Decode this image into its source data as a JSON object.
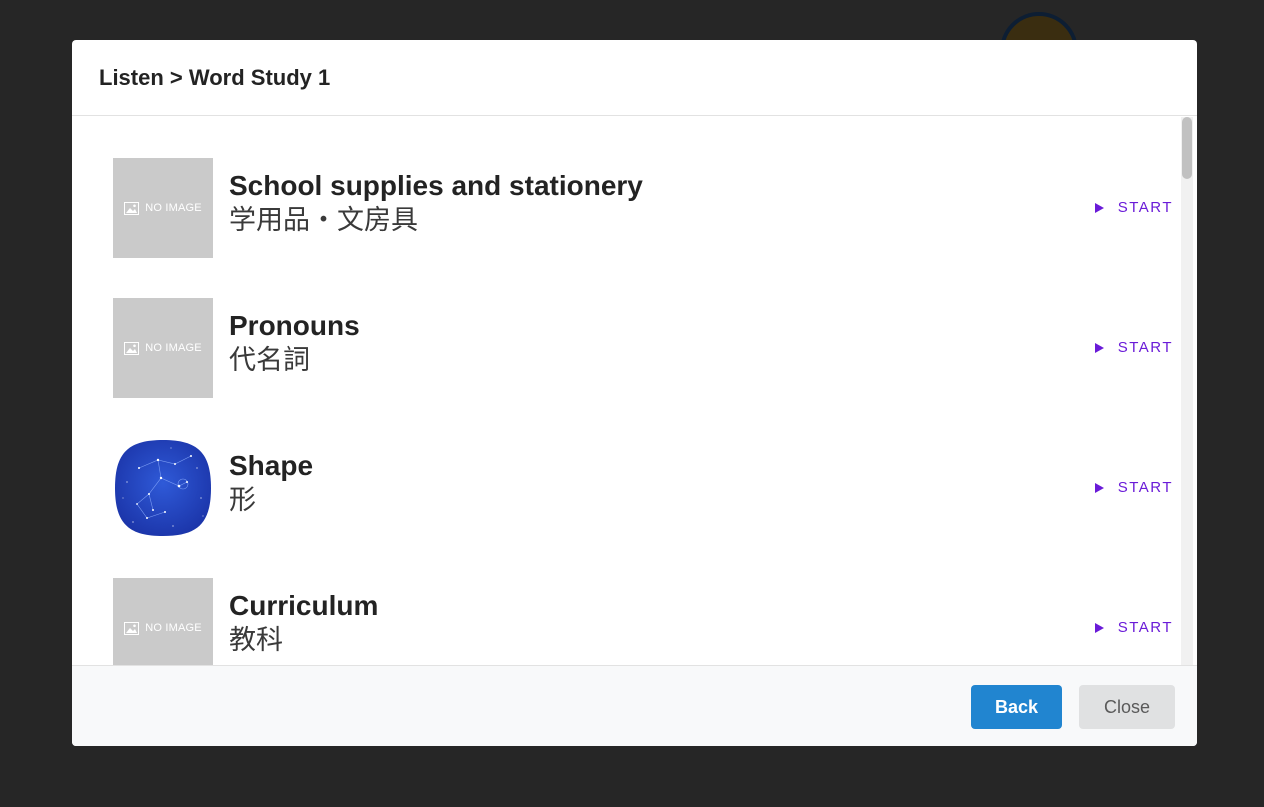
{
  "modal": {
    "title": "Listen > Word Study 1"
  },
  "items": [
    {
      "title_en": "School supplies and stationery",
      "title_ja": "学用品・文房具",
      "thumbnail": "NO IMAGE",
      "start_label": "START"
    },
    {
      "title_en": "Pronouns",
      "title_ja": "代名詞",
      "thumbnail": "NO IMAGE",
      "start_label": "START"
    },
    {
      "title_en": "Shape",
      "title_ja": "形",
      "thumbnail_icon": "constellation-image",
      "start_label": "START"
    },
    {
      "title_en": "Curriculum",
      "title_ja": "教科",
      "thumbnail": "NO IMAGE",
      "start_label": "START"
    }
  ],
  "footer": {
    "back_label": "Back",
    "close_label": "Close"
  },
  "colors": {
    "accent": "#6a1bd8",
    "primary_button": "#2185d0",
    "backdrop": "#262626"
  }
}
